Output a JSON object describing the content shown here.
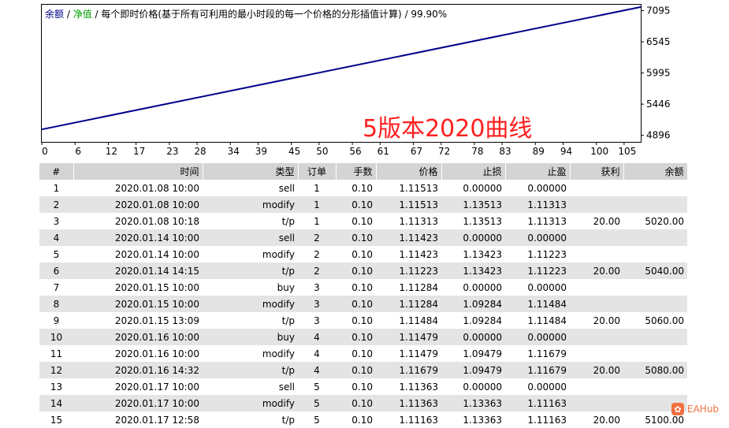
{
  "legend": {
    "balance": "余额",
    "sep1": " / ",
    "equity": "净值",
    "sep2": " / ",
    "description": "每个即时价格(基于所有可利用的最小时段的每一个价格的分形插值计算)",
    "sep3": " / ",
    "quality": "99.90%"
  },
  "overlay_text": "5版本2020曲线",
  "colors": {
    "balance_line": "#00008b",
    "equity_label": "#00a000",
    "overlay": "#ff2020",
    "row_stripe": "#e4e4e4",
    "header_bg": "#d4d4d4"
  },
  "chart_data": {
    "type": "line",
    "title": "",
    "xlabel": "",
    "ylabel": "",
    "x_ticks": [
      0,
      6,
      12,
      17,
      23,
      28,
      34,
      39,
      45,
      50,
      56,
      61,
      67,
      72,
      78,
      83,
      89,
      94,
      100,
      105
    ],
    "y_ticks": [
      4896,
      5446,
      5995,
      6545,
      7095
    ],
    "xlim": [
      0,
      108
    ],
    "ylim": [
      4780,
      7200
    ],
    "grid": false,
    "series": [
      {
        "name": "余额",
        "x": [
          0,
          108
        ],
        "y": [
          5000,
          7160
        ]
      }
    ]
  },
  "table": {
    "headers": [
      "#",
      "时间",
      "类型",
      "订单",
      "手数",
      "价格",
      "止损",
      "止盈",
      "获利",
      "余额"
    ],
    "rows": [
      [
        "1",
        "2020.01.08 10:00",
        "sell",
        "1",
        "0.10",
        "1.11513",
        "0.00000",
        "0.00000",
        "",
        ""
      ],
      [
        "2",
        "2020.01.08 10:00",
        "modify",
        "1",
        "0.10",
        "1.11513",
        "1.13513",
        "1.11313",
        "",
        ""
      ],
      [
        "3",
        "2020.01.08 10:18",
        "t/p",
        "1",
        "0.10",
        "1.11313",
        "1.13513",
        "1.11313",
        "20.00",
        "5020.00"
      ],
      [
        "4",
        "2020.01.14 10:00",
        "sell",
        "2",
        "0.10",
        "1.11423",
        "0.00000",
        "0.00000",
        "",
        ""
      ],
      [
        "5",
        "2020.01.14 10:00",
        "modify",
        "2",
        "0.10",
        "1.11423",
        "1.13423",
        "1.11223",
        "",
        ""
      ],
      [
        "6",
        "2020.01.14 14:15",
        "t/p",
        "2",
        "0.10",
        "1.11223",
        "1.13423",
        "1.11223",
        "20.00",
        "5040.00"
      ],
      [
        "7",
        "2020.01.15 10:00",
        "buy",
        "3",
        "0.10",
        "1.11284",
        "0.00000",
        "0.00000",
        "",
        ""
      ],
      [
        "8",
        "2020.01.15 10:00",
        "modify",
        "3",
        "0.10",
        "1.11284",
        "1.09284",
        "1.11484",
        "",
        ""
      ],
      [
        "9",
        "2020.01.15 13:09",
        "t/p",
        "3",
        "0.10",
        "1.11484",
        "1.09284",
        "1.11484",
        "20.00",
        "5060.00"
      ],
      [
        "10",
        "2020.01.16 10:00",
        "buy",
        "4",
        "0.10",
        "1.11479",
        "0.00000",
        "0.00000",
        "",
        ""
      ],
      [
        "11",
        "2020.01.16 10:00",
        "modify",
        "4",
        "0.10",
        "1.11479",
        "1.09479",
        "1.11679",
        "",
        ""
      ],
      [
        "12",
        "2020.01.16 14:32",
        "t/p",
        "4",
        "0.10",
        "1.11679",
        "1.09479",
        "1.11679",
        "20.00",
        "5080.00"
      ],
      [
        "13",
        "2020.01.17 10:00",
        "sell",
        "5",
        "0.10",
        "1.11363",
        "0.00000",
        "0.00000",
        "",
        ""
      ],
      [
        "14",
        "2020.01.17 10:00",
        "modify",
        "5",
        "0.10",
        "1.11363",
        "1.13363",
        "1.11163",
        "",
        ""
      ],
      [
        "15",
        "2020.01.17 12:58",
        "t/p",
        "5",
        "0.10",
        "1.11163",
        "1.13363",
        "1.11163",
        "20.00",
        "5100.00"
      ]
    ]
  },
  "logo": {
    "text": "EAHub",
    "icon": "eahub-logo-icon"
  }
}
